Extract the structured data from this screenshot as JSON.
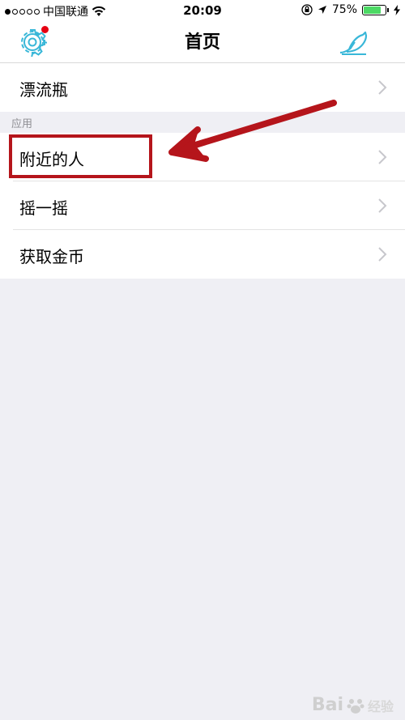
{
  "status_bar": {
    "carrier": "中国联通",
    "time": "20:09",
    "battery": "75%",
    "battery_color": "#4cd964",
    "signal_icon": "signal-dots-icon",
    "wifi_icon": "wifi-icon",
    "lock_icon": "rotation-lock-icon",
    "location_icon": "location-arrow-icon",
    "charging_icon": "charging-bolt-icon"
  },
  "nav": {
    "title": "首页",
    "settings_icon": "gear-icon",
    "settings_badge_color": "#e60012",
    "right_icon": "bird-icon",
    "icon_color": "#39b7d8"
  },
  "list": {
    "drift_bottle": "漂流瓶",
    "section_title": "应用",
    "nearby": "附近的人",
    "shake": "摇一摇",
    "get_coins": "获取金币"
  },
  "annotation": {
    "color": "#b5151b"
  },
  "watermark": {
    "text": "Bai",
    "sub": "经验"
  }
}
